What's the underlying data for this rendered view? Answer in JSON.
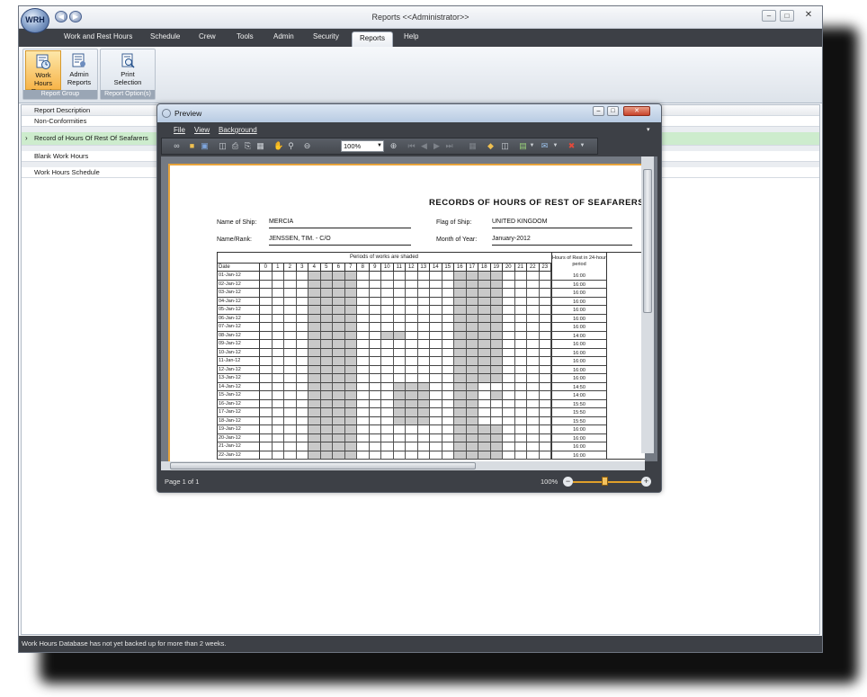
{
  "app": {
    "logo_text": "WRH",
    "title": "Reports <<Administrator>>",
    "minimize": "–",
    "maximize": "□",
    "close": "✕"
  },
  "ribbon_tabs": [
    "Work and Rest Hours",
    "Schedule",
    "Crew",
    "Tools",
    "Admin",
    "Security",
    "Reports",
    "Help"
  ],
  "active_tab": "Reports",
  "ribbon": {
    "groups": [
      {
        "label": "Report Group",
        "buttons": [
          {
            "label": "Work Hours Reports",
            "icon": "clock-report-icon"
          },
          {
            "label": "Admin Reports",
            "icon": "admin-report-icon"
          }
        ]
      },
      {
        "label": "Report Option(s)",
        "buttons": [
          {
            "label": "Print Selection",
            "icon": "print-preview-icon"
          }
        ]
      }
    ]
  },
  "report_list": {
    "header": "Report Description",
    "items": [
      "Non-Conformities",
      "Record of Hours Of Rest Of Seafarers",
      "Blank Work Hours",
      "Work Hours Schedule"
    ],
    "selected_index": 1,
    "selected_marker": "›"
  },
  "status": "Work Hours Database has not yet backed up for more than 2 weeks.",
  "preview": {
    "title": "Preview",
    "menu": [
      "File",
      "View",
      "Background"
    ],
    "zoom": "100%",
    "page_status": "Page 1 of 1",
    "zoom_status": "100%",
    "document": {
      "title": "RECORDS OF HOURS OF REST OF SEAFARERS",
      "fields": [
        {
          "label": "Name of Ship:",
          "value": "MERCIA"
        },
        {
          "label": "Flag of Ship:",
          "value": "UNITED KINGDOM"
        },
        {
          "label": "Name/Rank:",
          "value": "JENSSEN, TIM. - C/O"
        },
        {
          "label": "Month of Year:",
          "value": "January-2012"
        }
      ],
      "grid_header": "Periods of works are shaded",
      "rest_header": "Hours of Rest in 24-hour period",
      "date_header": "Date",
      "hours": [
        "0",
        "1",
        "2",
        "3",
        "4",
        "5",
        "6",
        "7",
        "8",
        "9",
        "10",
        "11",
        "12",
        "13",
        "14",
        "15",
        "16",
        "17",
        "18",
        "19",
        "20",
        "21",
        "22",
        "23"
      ],
      "rows": [
        {
          "date": "01-Jan-12",
          "rest": "16:00",
          "work": [
            [
              4,
              8
            ],
            [
              16,
              20
            ]
          ]
        },
        {
          "date": "02-Jan-12",
          "rest": "16:00",
          "work": [
            [
              4,
              8
            ],
            [
              16,
              20
            ]
          ]
        },
        {
          "date": "03-Jan-12",
          "rest": "16:00",
          "work": [
            [
              4,
              8
            ],
            [
              16,
              20
            ]
          ]
        },
        {
          "date": "04-Jan-12",
          "rest": "16:00",
          "work": [
            [
              4,
              8
            ],
            [
              16,
              20
            ]
          ]
        },
        {
          "date": "05-Jan-12",
          "rest": "16:00",
          "work": [
            [
              4,
              8
            ],
            [
              16,
              20
            ]
          ]
        },
        {
          "date": "06-Jan-12",
          "rest": "16:00",
          "work": [
            [
              4,
              8
            ],
            [
              16,
              20
            ]
          ]
        },
        {
          "date": "07-Jan-12",
          "rest": "16:00",
          "work": [
            [
              4,
              8
            ],
            [
              16,
              20
            ]
          ]
        },
        {
          "date": "08-Jan-12",
          "rest": "14:00",
          "work": [
            [
              4,
              8
            ],
            [
              10,
              12
            ],
            [
              16,
              20
            ]
          ]
        },
        {
          "date": "09-Jan-12",
          "rest": "16:00",
          "work": [
            [
              4,
              8
            ],
            [
              16,
              20
            ]
          ]
        },
        {
          "date": "10-Jan-12",
          "rest": "16:00",
          "work": [
            [
              4,
              8
            ],
            [
              16,
              20
            ]
          ]
        },
        {
          "date": "11-Jan-12",
          "rest": "16:00",
          "work": [
            [
              4,
              8
            ],
            [
              16,
              20
            ]
          ]
        },
        {
          "date": "12-Jan-12",
          "rest": "16:00",
          "work": [
            [
              4,
              8
            ],
            [
              16,
              20
            ]
          ]
        },
        {
          "date": "13-Jan-12",
          "rest": "16:00",
          "work": [
            [
              4,
              8
            ],
            [
              16,
              20
            ]
          ]
        },
        {
          "date": "14-Jan-12",
          "rest": "14:50",
          "work": [
            [
              4,
              8
            ],
            [
              11,
              14
            ],
            [
              16,
              18
            ]
          ]
        },
        {
          "date": "15-Jan-12",
          "rest": "14:00",
          "work": [
            [
              4,
              8
            ],
            [
              11,
              14
            ],
            [
              16,
              18
            ],
            [
              19,
              20
            ]
          ]
        },
        {
          "date": "16-Jan-12",
          "rest": "15:50",
          "work": [
            [
              4,
              8
            ],
            [
              11,
              14
            ],
            [
              16,
              18
            ]
          ]
        },
        {
          "date": "17-Jan-12",
          "rest": "15:50",
          "work": [
            [
              4,
              8
            ],
            [
              11,
              14
            ],
            [
              16,
              18
            ]
          ]
        },
        {
          "date": "18-Jan-12",
          "rest": "15:50",
          "work": [
            [
              4,
              8
            ],
            [
              11,
              14
            ],
            [
              16,
              18
            ]
          ]
        },
        {
          "date": "19-Jan-12",
          "rest": "16:00",
          "work": [
            [
              4,
              8
            ],
            [
              16,
              20
            ]
          ]
        },
        {
          "date": "20-Jan-12",
          "rest": "16:00",
          "work": [
            [
              4,
              8
            ],
            [
              16,
              20
            ]
          ]
        },
        {
          "date": "21-Jan-12",
          "rest": "16:00",
          "work": [
            [
              4,
              8
            ],
            [
              16,
              20
            ]
          ]
        },
        {
          "date": "22-Jan-12",
          "rest": "16:00",
          "work": [
            [
              4,
              8
            ],
            [
              16,
              20
            ]
          ]
        }
      ]
    }
  }
}
